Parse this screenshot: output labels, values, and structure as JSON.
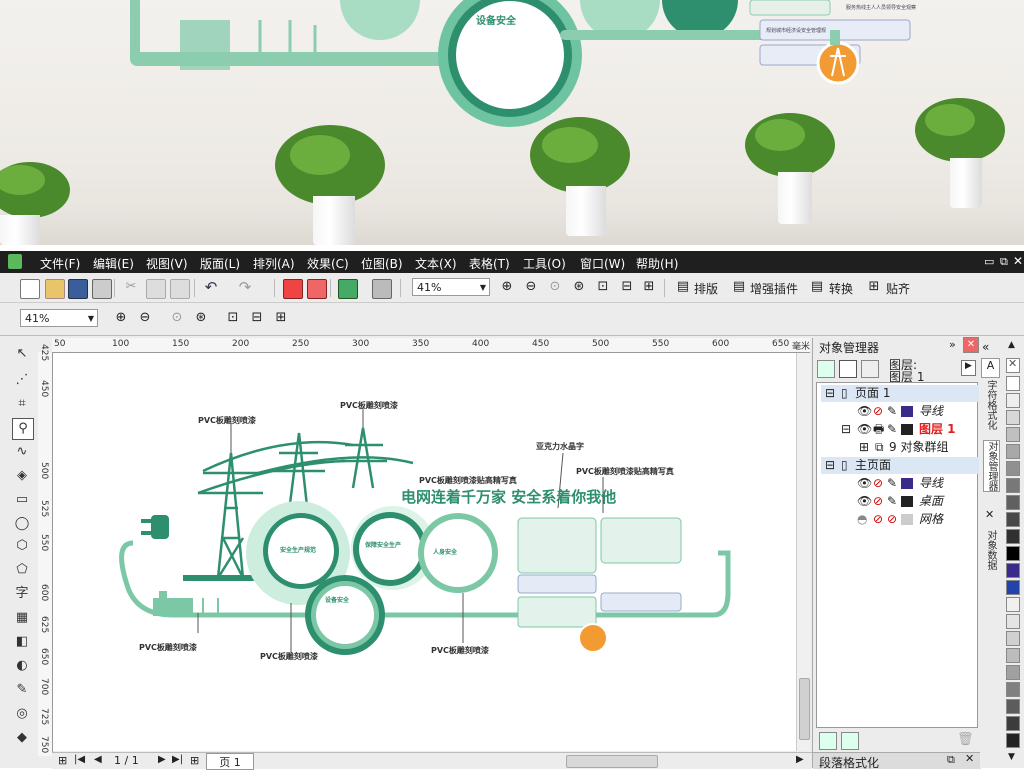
{
  "preview": {
    "sign_title": "设备安全",
    "sign_label_top": "服务热线主人人员领导安全观察",
    "sign_label_mid": "规划城市经济设安全管理规"
  },
  "menu": [
    "文件(F)",
    "编辑(E)",
    "视图(V)",
    "版面(L)",
    "排列(A)",
    "效果(C)",
    "位图(B)",
    "文本(X)",
    "表格(T)",
    "工具(O)",
    "窗口(W)",
    "帮助(H)"
  ],
  "toolbar": {
    "zoom_value": "41%",
    "zoom_value2": "41%",
    "arrange_label": "排版",
    "plugin_label": "增强插件",
    "convert_label": "转换",
    "paste_label": "贴齐"
  },
  "ruler": {
    "top": [
      "50",
      "100",
      "150",
      "200",
      "250",
      "300",
      "350",
      "400",
      "450",
      "500",
      "550",
      "600",
      "650",
      "毫米"
    ],
    "left": [
      "425",
      "450",
      "500",
      "525",
      "550",
      "600",
      "625",
      "650",
      "700",
      "725",
      "750"
    ]
  },
  "design": {
    "headline": "电网连着千万家  安全系着你我他",
    "labels": [
      "PVC板雕刻喷漆",
      "PVC板雕刻喷漆",
      "PVC板雕刻喷漆贴高精写真",
      "亚克力水晶字",
      "PVC板雕刻喷漆贴高精写真",
      "PVC板雕刻喷漆",
      "PVC板雕刻喷漆",
      "PVC板雕刻喷漆"
    ],
    "circle_titles": [
      "安全生产规范",
      "保障安全生产",
      "人身安全",
      "设备安全"
    ]
  },
  "docker": {
    "title": "对象管理器",
    "layer_label": "图层:",
    "layer_name": "图层 1",
    "tree": [
      {
        "text": "页面 1"
      },
      {
        "text": "导线"
      },
      {
        "text": "图层 1"
      },
      {
        "text": "9 对象群组"
      },
      {
        "text": "主页面"
      },
      {
        "text": "导线"
      },
      {
        "text": "桌面"
      },
      {
        "text": "网格"
      }
    ],
    "bottom_label": "段落格式化"
  },
  "side_tabs": [
    "字符格式化",
    "对象管理器",
    "对象数据"
  ],
  "status": {
    "page_counter": "1 / 1",
    "page_tab": "页 1"
  },
  "colors": {
    "accent": "#2e8f6f",
    "light_green": "#a8dcc3",
    "orange": "#f29b32",
    "layer_red": "#e02020",
    "layer_purple": "#3a2a8a"
  }
}
